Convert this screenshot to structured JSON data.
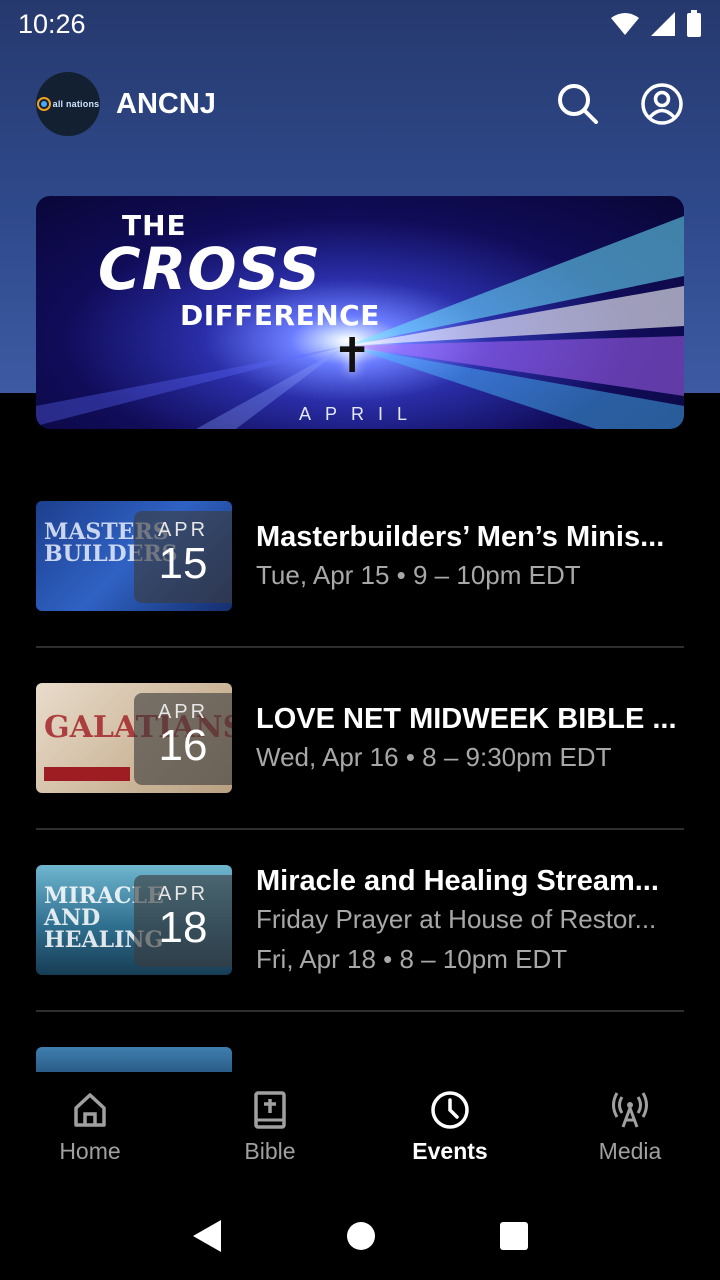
{
  "status_bar": {
    "time": "10:26"
  },
  "header": {
    "title": "ANCNJ",
    "avatar_text": "all nations"
  },
  "banner": {
    "title_line1": "THE",
    "title_line2": "CROSS",
    "title_line3": "DIFFERENCE",
    "month": "APRIL",
    "accent_color": "#2a2ea8"
  },
  "events": [
    {
      "title": "Masterbuilders’ Men’s Minis...",
      "subtitle": "",
      "datetime": "Tue, Apr 15 • 9 – 10pm EDT",
      "badge_month": "APR",
      "badge_day": "15",
      "thumb_text": "MASTERS BUILDERS",
      "thumb_color": "#1f4fa0"
    },
    {
      "title": "LOVE NET MIDWEEK BIBLE ...",
      "subtitle": "",
      "datetime": "Wed, Apr 16 • 8 – 9:30pm EDT",
      "badge_month": "APR",
      "badge_day": "16",
      "thumb_text": "GALATIANS",
      "thumb_color": "#d8c6ae"
    },
    {
      "title": "Miracle and Healing Stream...",
      "subtitle": "Friday Prayer at House of Restor...",
      "datetime": "Fri, Apr 18 • 8 – 10pm EDT",
      "badge_month": "APR",
      "badge_day": "18",
      "thumb_text": "MIRACLE AND HEALING",
      "thumb_color": "#3a7ea0"
    }
  ],
  "bottom_nav": {
    "items": [
      {
        "label": "Home",
        "icon": "home-icon"
      },
      {
        "label": "Bible",
        "icon": "bible-icon"
      },
      {
        "label": "Events",
        "icon": "clock-icon",
        "active": true
      },
      {
        "label": "Media",
        "icon": "broadcast-icon"
      }
    ]
  }
}
